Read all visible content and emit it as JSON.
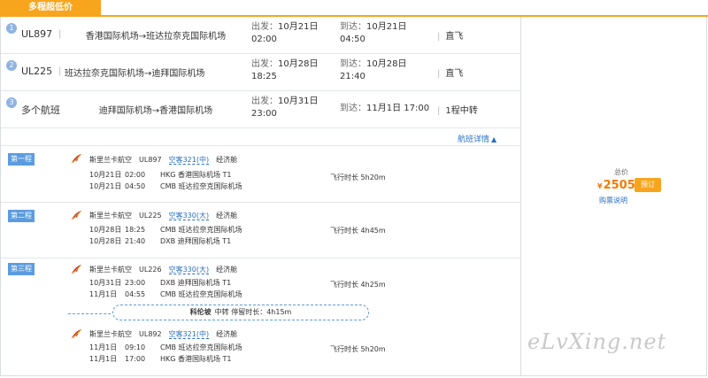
{
  "header": {
    "tab_label": "多程超低价"
  },
  "summary": [
    {
      "num": "1",
      "flight": "UL897",
      "route": "香港国际机场→班达拉奈克国际机场",
      "dep_label": "出发：",
      "dep_date": "10月21日",
      "dep_time": "02:00",
      "arr_label": "到达：",
      "arr_date": "10月21日",
      "arr_time": "04:50",
      "stop": "直飞"
    },
    {
      "num": "2",
      "flight": "UL225",
      "route": "班达拉奈克国际机场→迪拜国际机场",
      "dep_label": "出发：",
      "dep_date": "10月28日",
      "dep_time": "18:25",
      "arr_label": "到达：",
      "arr_date": "10月28日",
      "arr_time": "21:40",
      "stop": "直飞"
    },
    {
      "num": "3",
      "flight": "多个航班",
      "route": "迪拜国际机场→香港国际机场",
      "dep_label": "出发：",
      "dep_date": "10月31日",
      "dep_time": "23:00",
      "arr_label": "到达：",
      "arr_date": "11月1日 17:00",
      "arr_time": "",
      "stop": "1程中转"
    }
  ],
  "details_link": "航班详情",
  "segments": [
    {
      "badge": "第一程",
      "airline": "斯里兰卡航空",
      "flight": "UL897",
      "plane": "空客321(中)",
      "cabin": "经济舱",
      "dep_date": "10月21日",
      "dep_time": "02:00",
      "dep_airport": "HKG 香港国际机场 T1",
      "arr_date": "10月21日",
      "arr_time": "04:50",
      "arr_airport": "CMB 班达拉奈克国际机场",
      "duration": "飞行时长 5h20m"
    },
    {
      "badge": "第二程",
      "airline": "斯里兰卡航空",
      "flight": "UL225",
      "plane": "空客330(大)",
      "cabin": "经济舱",
      "dep_date": "10月28日",
      "dep_time": "18:25",
      "dep_airport": "CMB 班达拉奈克国际机场",
      "arr_date": "10月28日",
      "arr_time": "21:40",
      "arr_airport": "DXB 迪拜国际机场 T1",
      "duration": "飞行时长 4h45m"
    },
    {
      "badge": "第三程",
      "airline": "斯里兰卡航空",
      "flight": "UL226",
      "plane": "空客330(大)",
      "cabin": "经济舱",
      "dep_date": "10月31日",
      "dep_time": "23:00",
      "dep_airport": "DXB 迪拜国际机场 T1",
      "arr_date": "11月1日",
      "arr_time": "04:55",
      "arr_airport": "CMB 班达拉奈克国际机场",
      "duration": "飞行时长 4h25m"
    },
    {
      "badge": "",
      "airline": "斯里兰卡航空",
      "flight": "UL892",
      "plane": "空客321(中)",
      "cabin": "经济舱",
      "dep_date": "11月1日",
      "dep_time": "09:10",
      "dep_airport": "CMB 班达拉奈克国际机场",
      "arr_date": "11月1日",
      "arr_time": "17:00",
      "arr_airport": "HKG 香港国际机场 T1",
      "duration": "飞行时长 5h20m"
    }
  ],
  "transfer": {
    "city": "科伦坡",
    "text": "中转 停留时长：4h15m"
  },
  "pricing": {
    "label": "总价",
    "currency": "¥",
    "amount": "2505",
    "book": "预订",
    "note": "购票说明"
  },
  "watermark": "eLvXing.net",
  "colors": {
    "accent": "#f7a51d",
    "link": "#2a6fc4",
    "badge": "#5b9ce0",
    "price": "#f57a00"
  }
}
